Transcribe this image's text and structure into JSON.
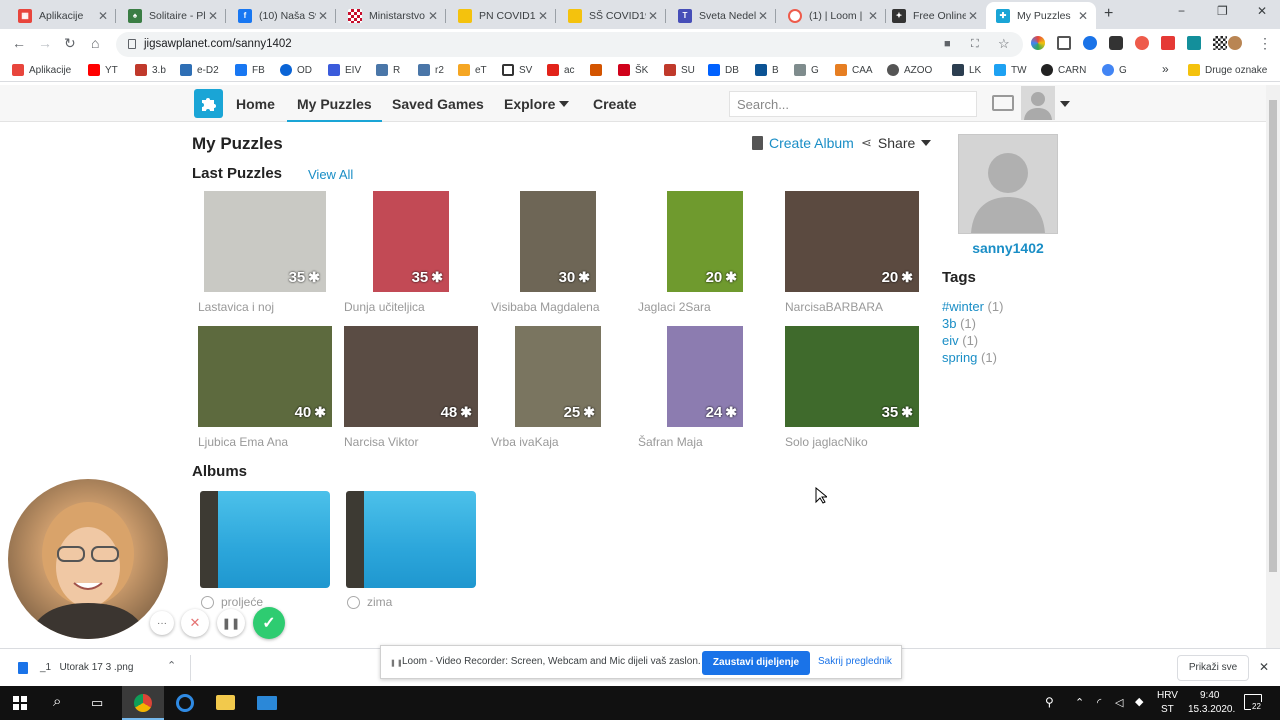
{
  "browser": {
    "tabs": [
      {
        "title": "Aplikacije",
        "icon": "apps-grid-icon",
        "color": "#e8453c"
      },
      {
        "title": "Solitaire - Pla",
        "icon": "solitaire-icon",
        "color": "#3a7d44"
      },
      {
        "title": "(10) Naša Sve",
        "icon": "facebook-icon",
        "color": "#1877f2"
      },
      {
        "title": "Ministarstvo",
        "icon": "croatia-crest-icon",
        "color": "#c8102e"
      },
      {
        "title": "PN COVID19",
        "icon": "folder-icon",
        "color": "#f4c20d"
      },
      {
        "title": "SŠ COVID19",
        "icon": "folder-icon",
        "color": "#f4c20d"
      },
      {
        "title": "Sveta Nedelj",
        "icon": "teams-icon",
        "color": "#464eb8"
      },
      {
        "title": "(1) | Loom |",
        "icon": "loom-icon",
        "color": "#ee5b4b"
      },
      {
        "title": "Free Online",
        "icon": "puzzle-icon",
        "color": "#333333"
      },
      {
        "title": "My Puzzles",
        "icon": "jigsaw-icon",
        "color": "#1aa5d6"
      }
    ],
    "new_tab": "+",
    "win_min": "−",
    "win_max": "❐",
    "win_close": "✕",
    "url": "jigsawplanet.com/sanny1402",
    "bookmarks": [
      {
        "label": "Aplikacije",
        "color": "#e8453c"
      },
      {
        "label": "YT",
        "color": "#ff0000"
      },
      {
        "label": "3.b",
        "color": "#c0392b"
      },
      {
        "label": "e-D2",
        "color": "#2f6fb5"
      },
      {
        "label": "FB",
        "color": "#1877f2"
      },
      {
        "label": "OD",
        "color": "#0a64d6"
      },
      {
        "label": "EIV",
        "color": "#3b5bdb"
      },
      {
        "label": "R",
        "color": "#4a76a8"
      },
      {
        "label": "r2",
        "color": "#4a76a8"
      },
      {
        "label": "eT",
        "color": "#f5a623"
      },
      {
        "label": "SV",
        "color": "#333333"
      },
      {
        "label": "ac",
        "color": "#e2231a"
      },
      {
        "label": "",
        "color": "#d35400"
      },
      {
        "label": "ŠK",
        "color": "#d0021b"
      },
      {
        "label": "SU",
        "color": "#c0392b"
      },
      {
        "label": "DB",
        "color": "#0061fe"
      },
      {
        "label": "B",
        "color": "#0b5394"
      },
      {
        "label": "G",
        "color": "#7f8c8d"
      },
      {
        "label": "CAA",
        "color": "#e67e22"
      },
      {
        "label": "AZOO",
        "color": "#555555"
      },
      {
        "label": "LK",
        "color": "#2c3e50"
      },
      {
        "label": "TW",
        "color": "#1da1f2"
      },
      {
        "label": "CARN",
        "color": "#222222"
      },
      {
        "label": "G",
        "color": "#4285f4"
      }
    ],
    "bookmarks_more": "»",
    "other_bookmarks": "Druge oznake"
  },
  "site": {
    "nav": {
      "home": "Home",
      "my_puzzles": "My Puzzles",
      "saved_games": "Saved Games",
      "explore": "Explore",
      "create": "Create"
    },
    "search_placeholder": "Search...",
    "accent": "#1aa5d6"
  },
  "main": {
    "page_title": "My Puzzles",
    "create_album": "Create Album",
    "share": "Share",
    "last_puzzles_heading": "Last Puzzles",
    "view_all": "View All",
    "puzzles": [
      {
        "title": "Lastavica i noj",
        "pieces": "35",
        "img": "#c9c9c4"
      },
      {
        "title": "Dunja učiteljica",
        "pieces": "35",
        "img": "#c24a55"
      },
      {
        "title": "Visibaba Magdalena",
        "pieces": "30",
        "img": "#6e6656"
      },
      {
        "title": "Jaglaci 2Sara",
        "pieces": "20",
        "img": "#6f9a2e"
      },
      {
        "title": "NarcisaBARBARA",
        "pieces": "20",
        "img": "#5b4a40"
      },
      {
        "title": "Ljubica Ema Ana",
        "pieces": "40",
        "img": "#5d6a3e"
      },
      {
        "title": "Narcisa Viktor",
        "pieces": "48",
        "img": "#5a4c44"
      },
      {
        "title": "Vrba ivaKaja",
        "pieces": "25",
        "img": "#7a7560"
      },
      {
        "title": "Šafran Maja",
        "pieces": "24",
        "img": "#8c7cb0"
      },
      {
        "title": "Solo jaglacNiko",
        "pieces": "35",
        "img": "#3f6a2c"
      }
    ],
    "albums_heading": "Albums",
    "albums": [
      {
        "title": "proljeće"
      },
      {
        "title": "zima"
      }
    ]
  },
  "sidebar": {
    "username": "sanny1402",
    "tags_heading": "Tags",
    "tags": [
      {
        "name": "#winter",
        "count": "(1)"
      },
      {
        "name": "3b",
        "count": "(1)"
      },
      {
        "name": "eiv",
        "count": "(1)"
      },
      {
        "name": "spring",
        "count": "(1)"
      }
    ]
  },
  "loom": {
    "more": "···",
    "cancel": "✕",
    "pause": "❚❚",
    "done": "✓",
    "share_message": "Loom - Video Recorder: Screen, Webcam and Mic dijeli vaš zaslon.",
    "stop_sharing": "Zaustavi dijeljenje",
    "hide": "Sakrij preglednik"
  },
  "downloads": {
    "file": "_1   Utorak 17 3 .png",
    "show_all": "Prikaži sve",
    "close": "✕"
  },
  "taskbar": {
    "lang": "HRV",
    "lang2": "ST",
    "time": "9:40",
    "date": "15.3.2020.",
    "notif": "22"
  }
}
